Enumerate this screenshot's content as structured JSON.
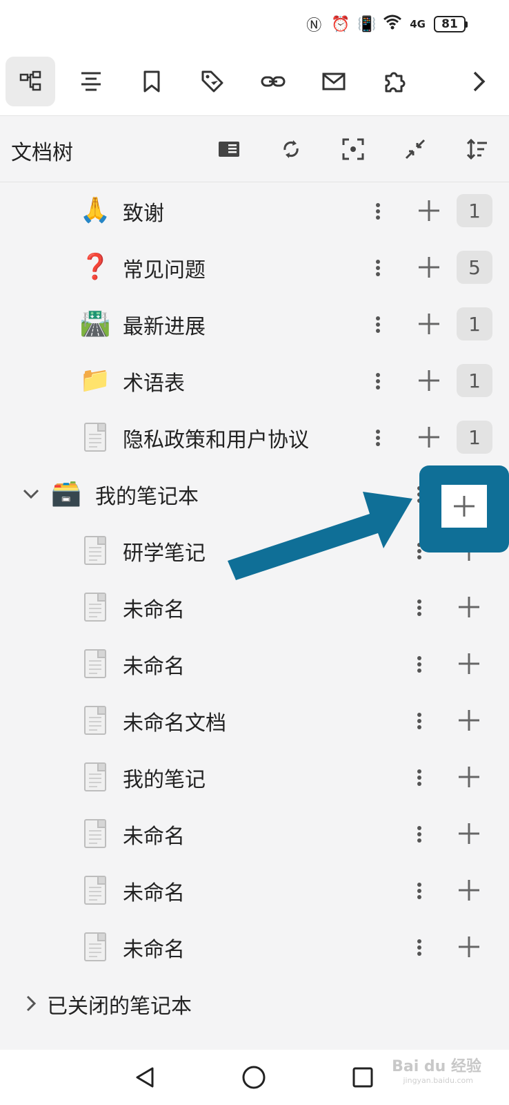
{
  "status_bar": {
    "network": "4G",
    "battery": "81"
  },
  "toolbar": {
    "tools": [
      {
        "icon": "file-tree-icon",
        "active": true
      },
      {
        "icon": "outline-icon"
      },
      {
        "icon": "bookmark-icon"
      },
      {
        "icon": "tag-icon"
      },
      {
        "icon": "backlink-icon"
      },
      {
        "icon": "inbox-icon"
      },
      {
        "icon": "plugin-icon"
      },
      {
        "icon": "chevron-right-icon"
      }
    ]
  },
  "panel": {
    "title": "文档树"
  },
  "tree": {
    "items": [
      {
        "emoji": "🙏",
        "label": "致谢",
        "count": "1"
      },
      {
        "emoji": "❓",
        "label": "常见问题",
        "count": "5"
      },
      {
        "emoji": "🛣️",
        "label": "最新进展",
        "count": "1"
      },
      {
        "emoji": "📁",
        "label": "术语表",
        "count": "1"
      },
      {
        "icon": "file",
        "label": "隐私政策和用户协议",
        "count": "1"
      }
    ],
    "notebook": {
      "emoji": "🗃️",
      "label": "我的笔记本",
      "docs": [
        {
          "label": "研学笔记"
        },
        {
          "label": "未命名"
        },
        {
          "label": "未命名"
        },
        {
          "label": "未命名文档"
        },
        {
          "label": "我的笔记"
        },
        {
          "label": "未命名"
        },
        {
          "label": "未命名"
        },
        {
          "label": "未命名"
        }
      ]
    },
    "closed_notebooks": "已关闭的笔记本"
  },
  "watermark": {
    "brand": "Bai du 经验",
    "url": "jingyan.baidu.com"
  },
  "colors": {
    "highlight": "#0f6f97",
    "background": "#f4f4f5"
  }
}
